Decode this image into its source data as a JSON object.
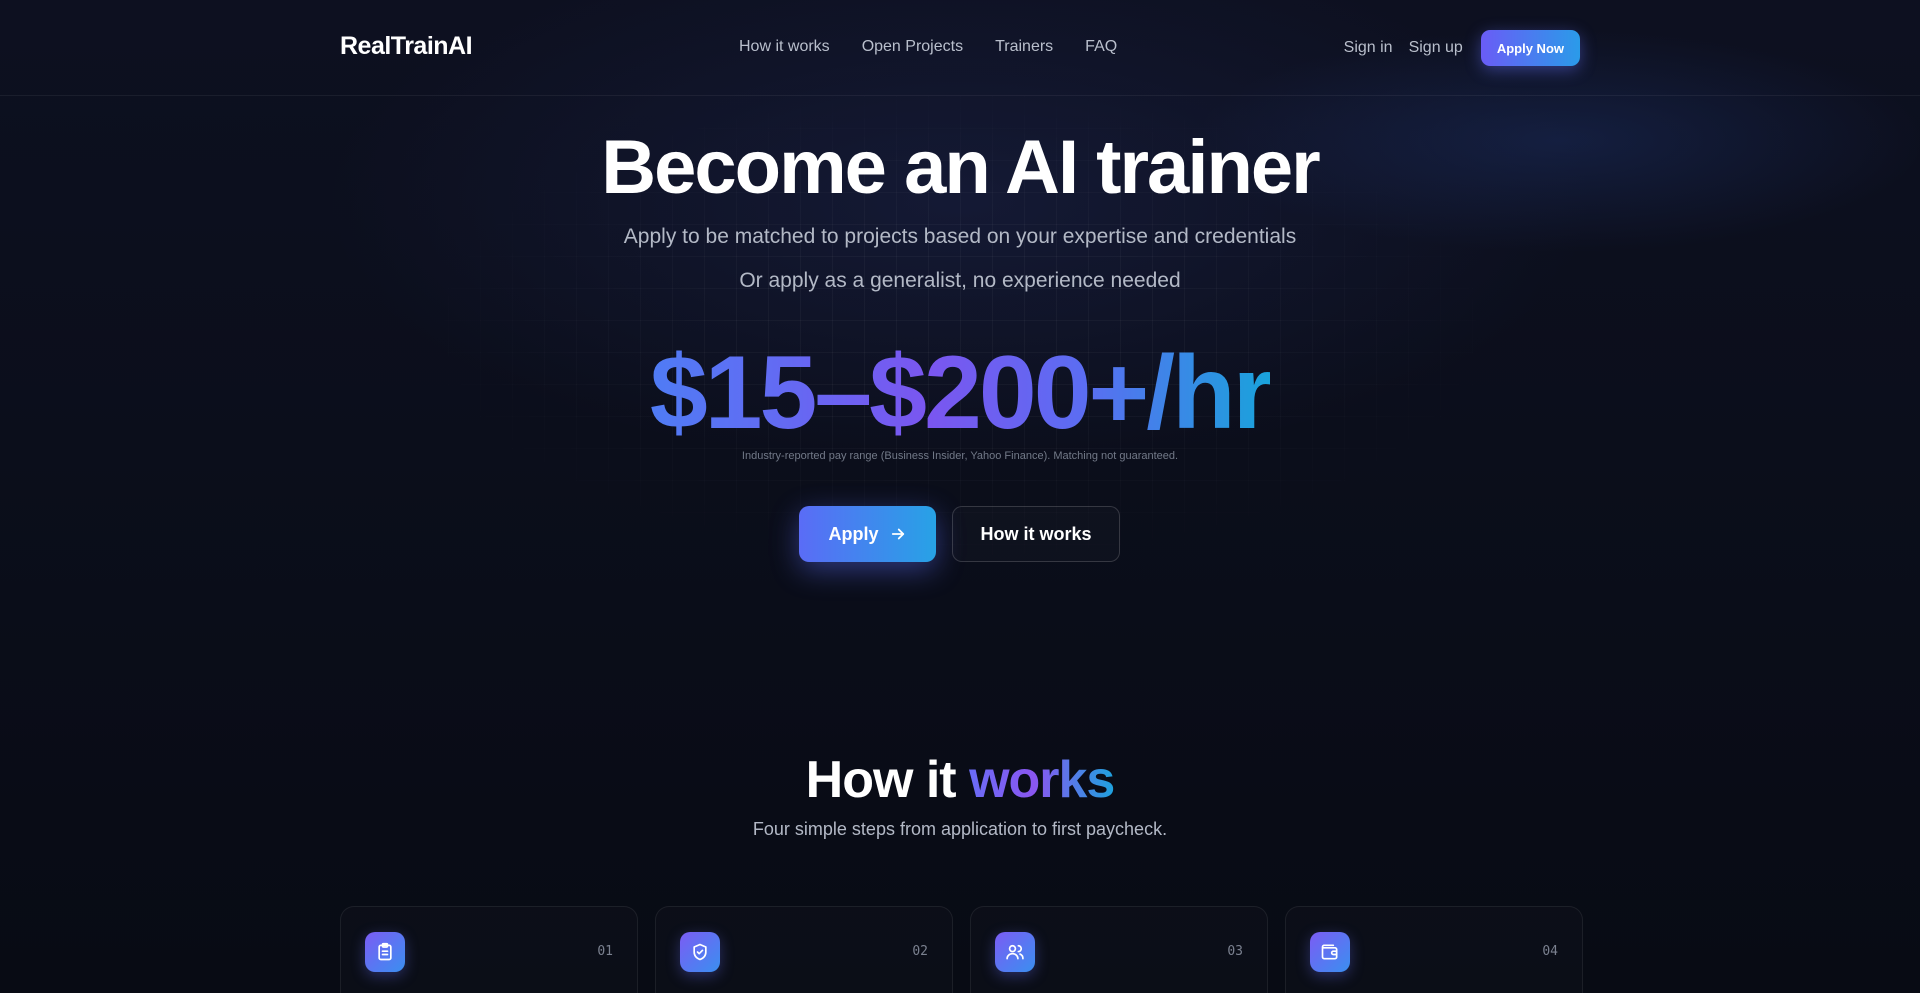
{
  "header": {
    "logo": "RealTrainAI",
    "nav": [
      "How it works",
      "Open Projects",
      "Trainers",
      "FAQ"
    ],
    "sign_in": "Sign in",
    "sign_up": "Sign up",
    "apply_now": "Apply Now"
  },
  "hero": {
    "title": "Become an AI trainer",
    "subtitle_1": "Apply to be matched to projects based on your expertise and credentials",
    "subtitle_2": "Or apply as a generalist, no experience needed",
    "pay_range": "$15–$200+/hr",
    "disclaimer": "Industry-reported pay range (Business Insider, Yahoo Finance). Matching not guaranteed.",
    "apply_button": "Apply",
    "how_button": "How it works"
  },
  "how": {
    "title_start": "How it ",
    "title_accent": "works",
    "subtitle": "Four simple steps from application to first paycheck.",
    "steps": [
      {
        "number": "01",
        "icon": "clipboard-icon"
      },
      {
        "number": "02",
        "icon": "shield-check-icon"
      },
      {
        "number": "03",
        "icon": "users-icon"
      },
      {
        "number": "04",
        "icon": "wallet-icon"
      }
    ]
  },
  "colors": {
    "background": "#090c16",
    "accent_start": "#6a5cf6",
    "accent_end": "#2a9be9"
  }
}
